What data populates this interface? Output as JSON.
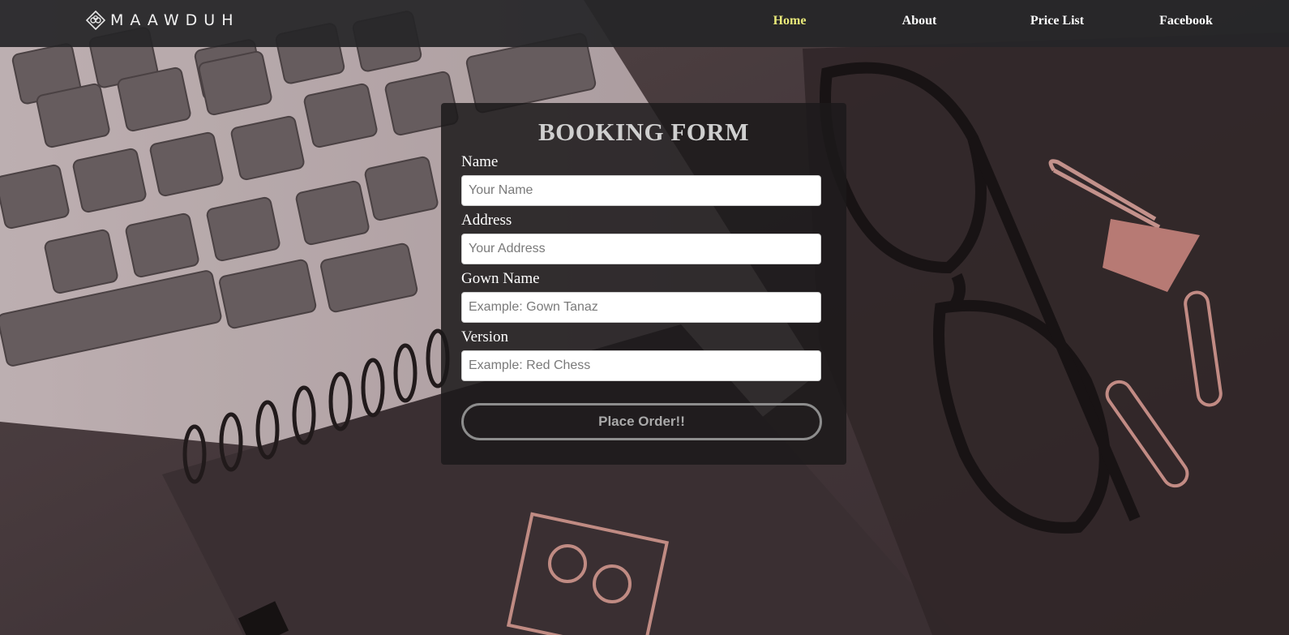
{
  "brand": {
    "name": "MAAWDUH"
  },
  "nav": {
    "items": [
      {
        "label": "Home",
        "active": true
      },
      {
        "label": "About",
        "active": false
      },
      {
        "label": "Price List",
        "active": false
      },
      {
        "label": "Facebook",
        "active": false
      }
    ]
  },
  "form": {
    "title": "BOOKING FORM",
    "fields": [
      {
        "label": "Name",
        "placeholder": "Your Name",
        "value": ""
      },
      {
        "label": "Address",
        "placeholder": "Your Address",
        "value": ""
      },
      {
        "label": "Gown Name",
        "placeholder": "Example: Gown Tanaz",
        "value": ""
      },
      {
        "label": "Version",
        "placeholder": "Example: Red Chess",
        "value": ""
      }
    ],
    "submit_label": "Place Order!!"
  },
  "colors": {
    "nav_active": "#eaea7a",
    "nav_bg": "#262628",
    "card_bg": "#1c1a1b"
  },
  "icons": {
    "logo": "diamond-flower-logo-icon"
  }
}
